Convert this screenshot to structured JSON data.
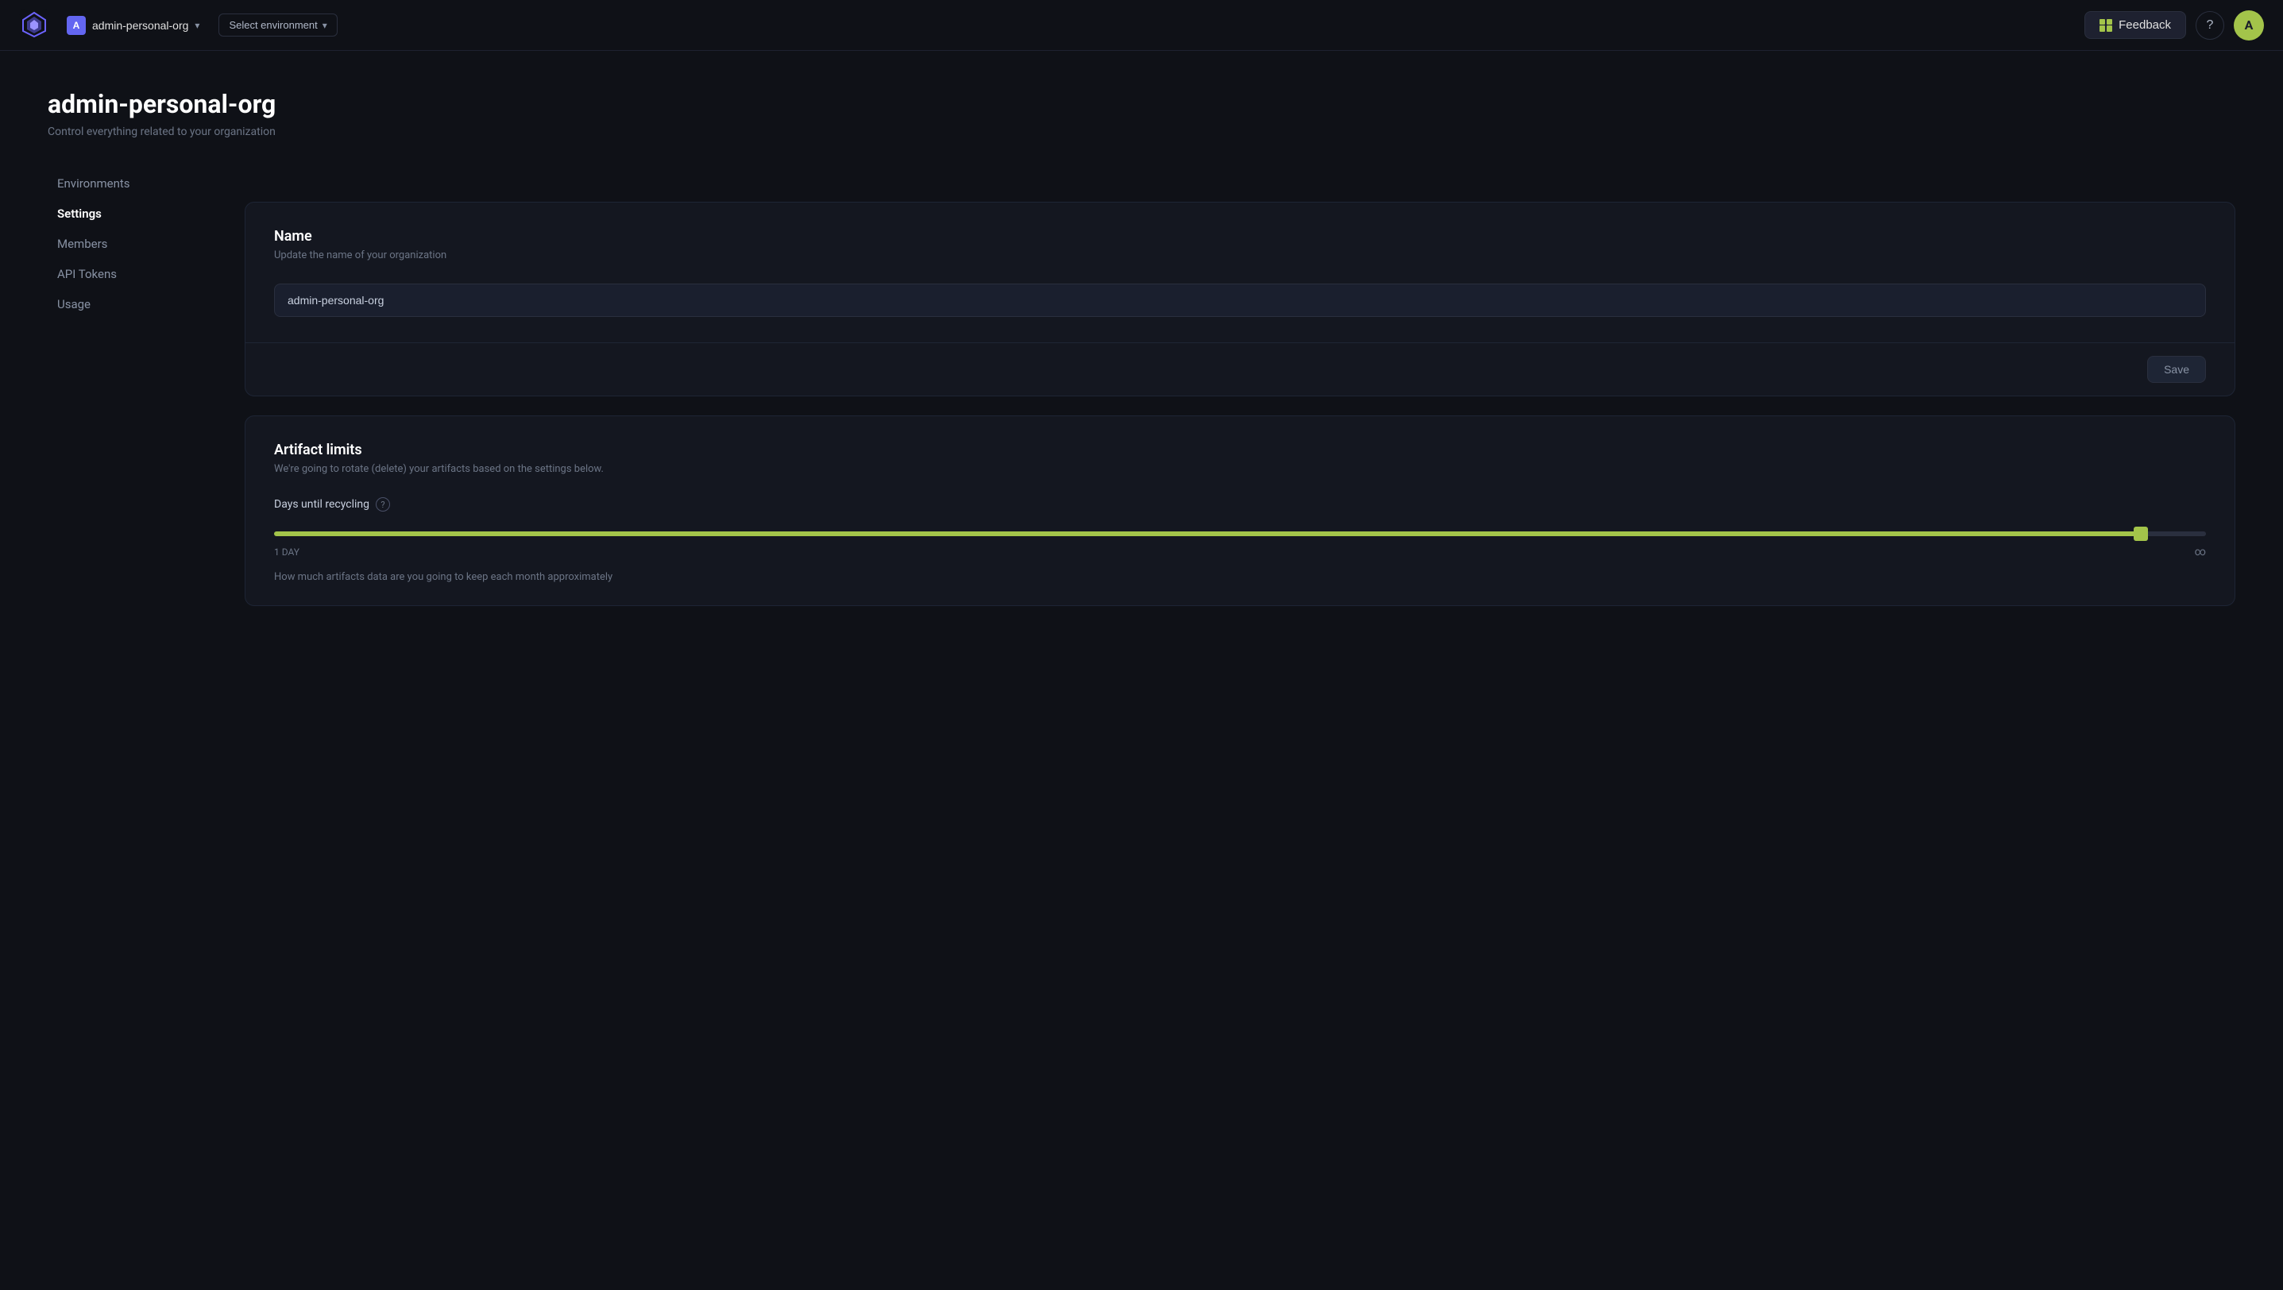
{
  "header": {
    "org_avatar": "A",
    "org_name": "admin-personal-org",
    "env_selector_label": "Select environment",
    "feedback_label": "Feedback",
    "help_label": "?",
    "user_avatar": "A"
  },
  "page": {
    "title": "admin-personal-org",
    "subtitle": "Control everything related to your organization"
  },
  "sidebar": {
    "items": [
      {
        "label": "Environments",
        "id": "environments",
        "active": false
      },
      {
        "label": "Settings",
        "id": "settings",
        "active": true
      },
      {
        "label": "Members",
        "id": "members",
        "active": false
      },
      {
        "label": "API Tokens",
        "id": "api-tokens",
        "active": false
      },
      {
        "label": "Usage",
        "id": "usage",
        "active": false
      }
    ]
  },
  "name_section": {
    "title": "Name",
    "description": "Update the name of your organization",
    "input_value": "admin-personal-org",
    "save_label": "Save"
  },
  "artifact_section": {
    "title": "Artifact limits",
    "description": "We're going to rotate (delete) your artifacts based on the settings below.",
    "slider_label": "Days until recycling",
    "slider_min": 1,
    "slider_max": 100,
    "slider_value": 97,
    "slider_min_label": "1 DAY",
    "slider_max_label": "∞",
    "keep_data_text": "How much artifacts data are you going to keep each month approximately"
  }
}
